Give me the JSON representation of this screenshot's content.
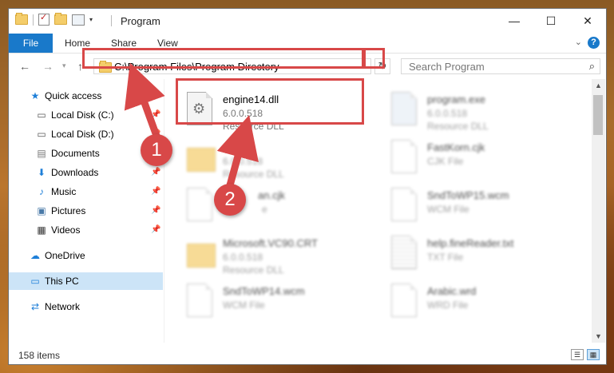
{
  "window": {
    "title": "Program",
    "controls": {
      "minimize": "—",
      "maximize": "☐",
      "close": "✕"
    }
  },
  "ribbon": {
    "tabs": [
      "File",
      "Home",
      "Share",
      "View"
    ],
    "help": "?"
  },
  "nav": {
    "address": "C:\\Program Files\\Program Directory",
    "search_placeholder": "Search Program"
  },
  "sidebar": {
    "items": [
      {
        "label": "Quick access",
        "icon": "star-icon",
        "pinned": false
      },
      {
        "label": "Local Disk (C:)",
        "icon": "drive-icon",
        "pinned": true
      },
      {
        "label": "Local Disk (D:)",
        "icon": "drive-icon",
        "pinned": true
      },
      {
        "label": "Documents",
        "icon": "documents-icon",
        "pinned": true
      },
      {
        "label": "Downloads",
        "icon": "download-icon",
        "pinned": true
      },
      {
        "label": "Music",
        "icon": "music-icon",
        "pinned": true
      },
      {
        "label": "Pictures",
        "icon": "pictures-icon",
        "pinned": true
      },
      {
        "label": "Videos",
        "icon": "videos-icon",
        "pinned": true
      },
      {
        "label": "OneDrive",
        "icon": "cloud-icon",
        "pinned": false
      },
      {
        "label": "This PC",
        "icon": "computer-icon",
        "pinned": false,
        "selected": true
      },
      {
        "label": "Network",
        "icon": "network-icon",
        "pinned": false
      }
    ]
  },
  "files": [
    {
      "name": "engine14.dll",
      "line1": "6.0.0.518",
      "line2": "Resource DLL",
      "icon": "dll-icon",
      "blurred": false
    },
    {
      "name": "program.exe",
      "line1": "6.0.0.518",
      "line2": "Resource DLL",
      "icon": "exe-icon",
      "blurred": true
    },
    {
      "name": "ei",
      "line1": "6.0.0.518",
      "line2": "Resource DLL",
      "icon": "folder-icon",
      "blurred": true
    },
    {
      "name": "FastKorn.cjk",
      "line1": "CJK File",
      "line2": "",
      "icon": "file-icon",
      "blurred": true
    },
    {
      "name": "an.cjk",
      "line1": "e",
      "line2": "",
      "icon": "file-icon",
      "blurred": true
    },
    {
      "name": "SndToWP15.wcm",
      "line1": "WCM File",
      "line2": "",
      "icon": "file-icon",
      "blurred": true
    },
    {
      "name": "Microsoft.VC90.CRT",
      "line1": "6.0.0.518",
      "line2": "Resource DLL",
      "icon": "folder-icon",
      "blurred": true
    },
    {
      "name": "help.fineReader.txt",
      "line1": "TXT File",
      "line2": "",
      "icon": "text-file-icon",
      "blurred": true
    },
    {
      "name": "SndToWP14.wcm",
      "line1": "WCM File",
      "line2": "",
      "icon": "file-icon",
      "blurred": true
    },
    {
      "name": "Arabic.wrd",
      "line1": "WRD File",
      "line2": "",
      "icon": "file-icon",
      "blurred": true
    }
  ],
  "status": {
    "count": "158 items"
  },
  "annotations": {
    "step1": "1",
    "step2": "2"
  },
  "colors": {
    "accent": "#1979ca",
    "highlight": "#d84848",
    "selected": "#cce4f7"
  }
}
